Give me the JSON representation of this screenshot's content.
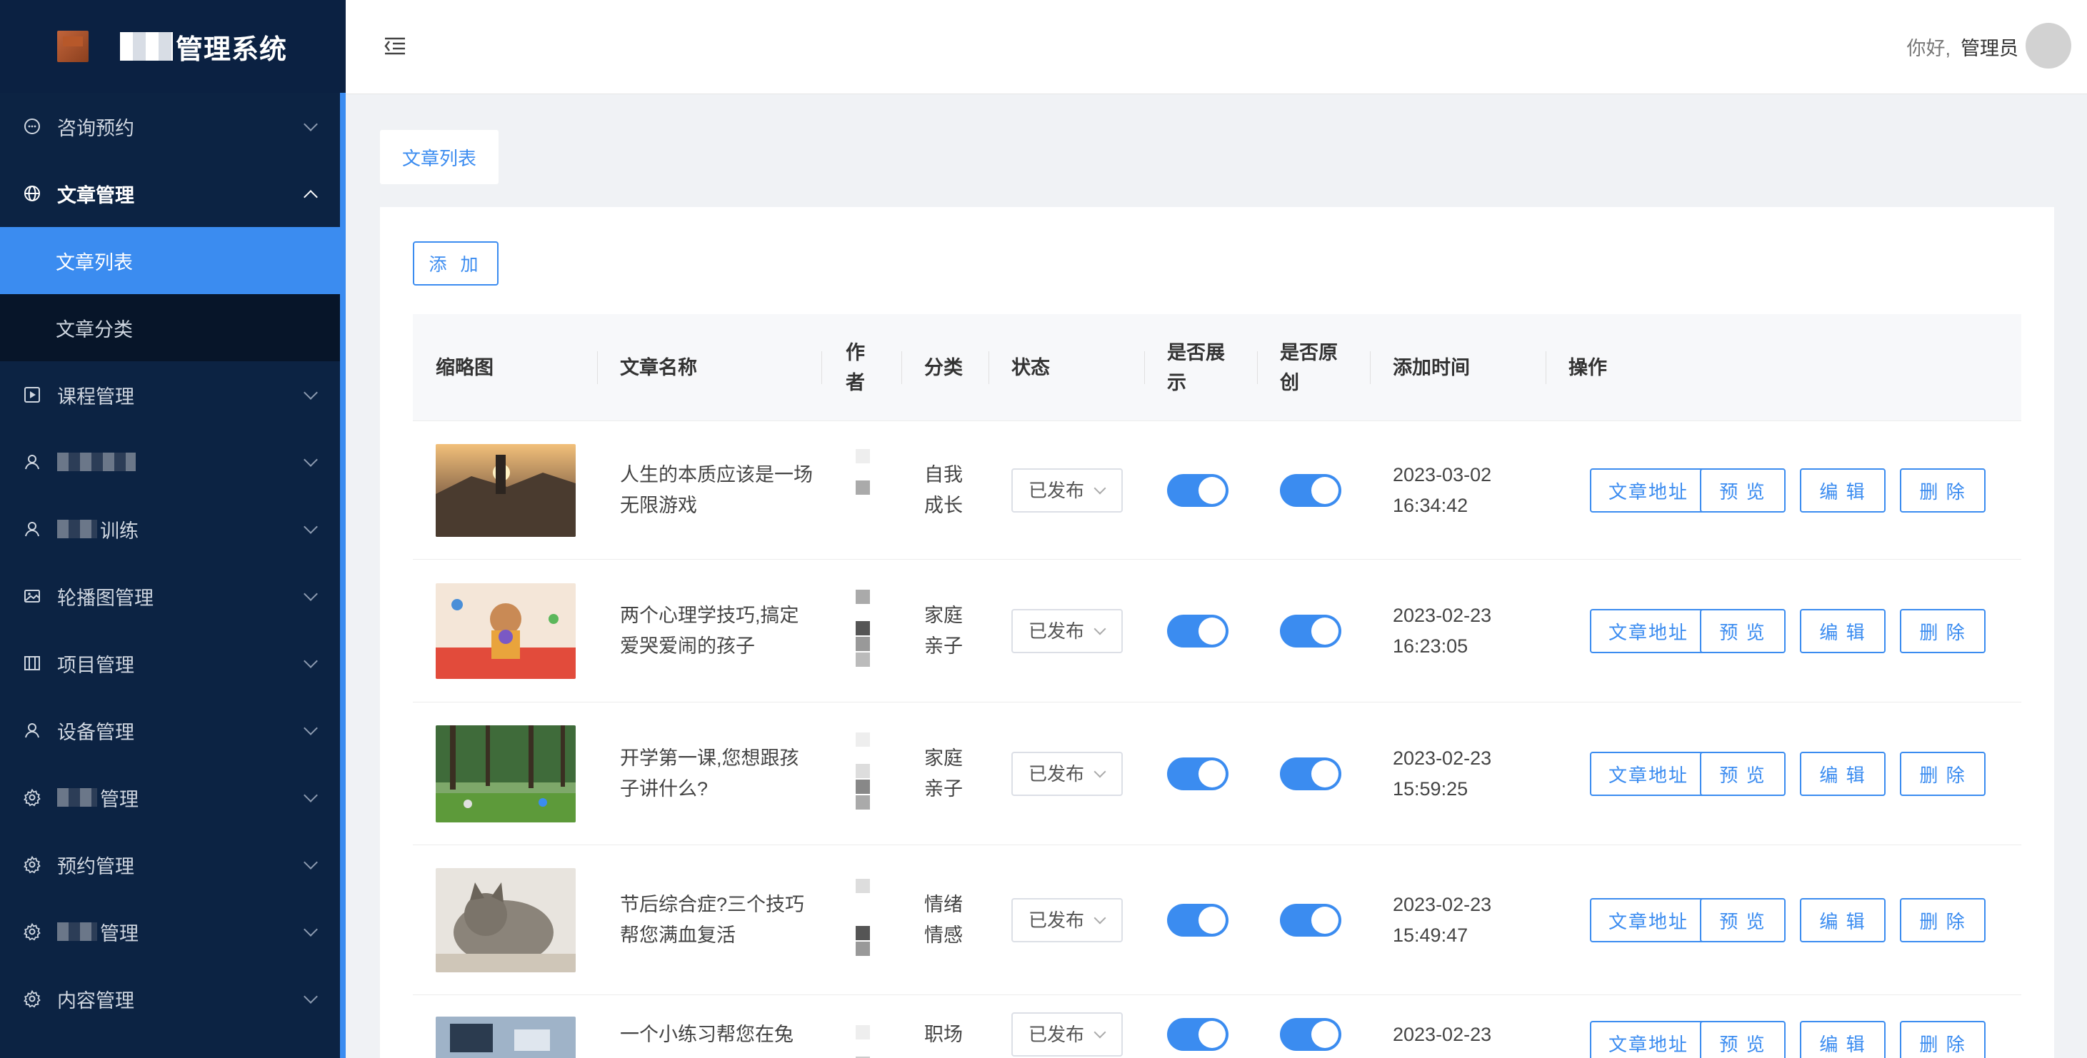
{
  "app": {
    "title": "管理系统"
  },
  "sidebar": {
    "items": [
      {
        "label": "咨询预约",
        "icon": "chat-icon",
        "open": false
      },
      {
        "label": "文章管理",
        "icon": "globe-icon",
        "open": true,
        "children": [
          {
            "label": "文章列表",
            "active": true
          },
          {
            "label": "文章分类",
            "active": false
          }
        ]
      },
      {
        "label": "课程管理",
        "icon": "play-square-icon",
        "open": false
      },
      {
        "label": "",
        "icon": "user-icon",
        "open": false,
        "redacted": true
      },
      {
        "label": "训练",
        "icon": "user-icon",
        "open": false,
        "redacted": true
      },
      {
        "label": "轮播图管理",
        "icon": "image-icon",
        "open": false
      },
      {
        "label": "项目管理",
        "icon": "book-icon",
        "open": false
      },
      {
        "label": "设备管理",
        "icon": "user-icon",
        "open": false
      },
      {
        "label": "管理",
        "icon": "gear-icon",
        "open": false,
        "redacted": true
      },
      {
        "label": "预约管理",
        "icon": "gear-icon",
        "open": false
      },
      {
        "label": "管理",
        "icon": "gear-icon",
        "open": false,
        "redacted": true
      },
      {
        "label": "内容管理",
        "icon": "gear-icon",
        "open": false
      }
    ]
  },
  "header": {
    "greeting": "你好,",
    "username": "管理员"
  },
  "tab": {
    "label": "文章列表"
  },
  "toolbar": {
    "add_label": "添 加"
  },
  "table": {
    "columns": {
      "thumb": "缩略图",
      "title": "文章名称",
      "author": "作者",
      "category": "分类",
      "status": "状态",
      "display": "是否展示",
      "original": "是否原创",
      "added": "添加时间",
      "actions": "操作"
    },
    "action_labels": {
      "url": "文章地址",
      "preview": "预 览",
      "edit": "编 辑",
      "delete": "删 除"
    },
    "rows": [
      {
        "title": "人生的本质应该是一场无限游戏",
        "category": "自我成长",
        "status": "已发布",
        "display": true,
        "original": true,
        "date": "2023-03-02",
        "time": "16:34:42",
        "thumb": "sunset"
      },
      {
        "title": "两个心理学技巧,搞定爱哭爱闹的孩子",
        "category": "家庭亲子",
        "status": "已发布",
        "display": true,
        "original": true,
        "date": "2023-02-23",
        "time": "16:23:05",
        "thumb": "child"
      },
      {
        "title": "开学第一课,您想跟孩子讲什么?",
        "category": "家庭亲子",
        "status": "已发布",
        "display": true,
        "original": true,
        "date": "2023-02-23",
        "time": "15:59:25",
        "thumb": "forest"
      },
      {
        "title": "节后综合症?三个技巧帮您满血复活",
        "category": "情绪情感",
        "status": "已发布",
        "display": true,
        "original": true,
        "date": "2023-02-23",
        "time": "15:49:47",
        "thumb": "cat"
      },
      {
        "title": "一个小练习帮您在兔",
        "category": "职场",
        "status": "已发布",
        "display": true,
        "original": true,
        "date": "2023-02-23",
        "time": "",
        "thumb": "desk"
      }
    ]
  }
}
